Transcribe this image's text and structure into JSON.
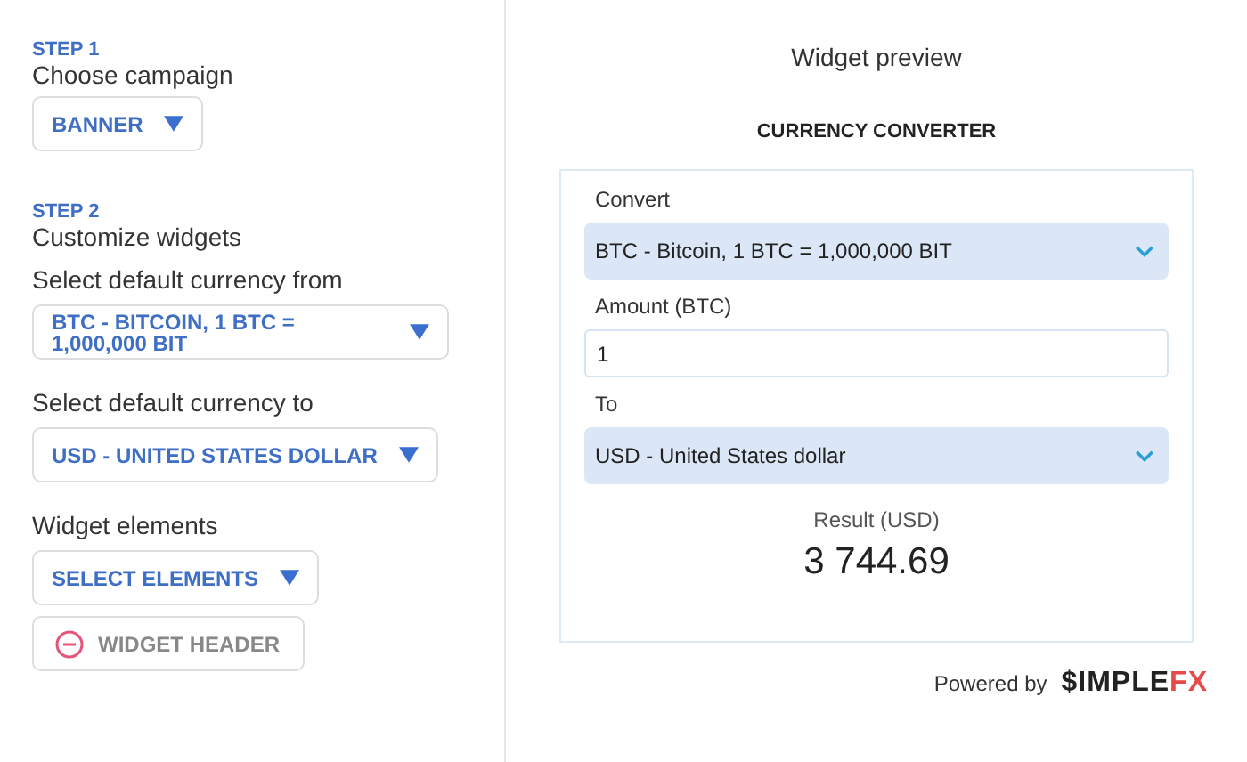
{
  "steps": [
    {
      "step": "STEP 1",
      "title": "Choose campaign",
      "fields": [
        {
          "dropdown": "BANNER"
        }
      ]
    },
    {
      "step": "STEP 2",
      "title": "Customize widgets",
      "fields": [
        {
          "label": "Select default currency from",
          "dropdown": "BTC - BITCOIN, 1 BTC = 1,000,000 BIT",
          "wide": true
        },
        {
          "label": "Select default currency to",
          "dropdown": "USD - UNITED STATES DOLLAR"
        },
        {
          "label": "Widget elements",
          "dropdown": "SELECT ELEMENTS"
        }
      ]
    }
  ],
  "chips": [
    {
      "label": "WIDGET HEADER",
      "removable": true
    }
  ],
  "preview": {
    "heading": "Widget preview",
    "widget_title": "CURRENCY CONVERTER",
    "fields": [
      {
        "kind": "select",
        "label": "Convert",
        "value": "BTC - Bitcoin, 1 BTC = 1,000,000 BIT"
      },
      {
        "kind": "input",
        "label": "Amount (BTC)",
        "value": "1"
      },
      {
        "kind": "select",
        "label": "To",
        "value": "USD - United States dollar"
      }
    ],
    "result_label": "Result (USD)",
    "result": "3 744.69",
    "powered_by": "Powered by",
    "logo": {
      "main": "$IMPLE",
      "accent": "FX"
    }
  }
}
